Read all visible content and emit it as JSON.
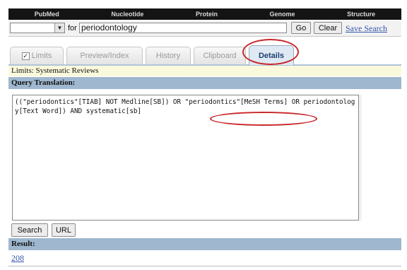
{
  "topnav": [
    "PubMed",
    "Nucleotide",
    "Protein",
    "Genome",
    "Structure"
  ],
  "search": {
    "for_label": "for",
    "term": "periodontology",
    "go_label": "Go",
    "clear_label": "Clear",
    "save_label": "Save Search"
  },
  "tabs": {
    "limits": "Limits",
    "preview": "Preview/Index",
    "history": "History",
    "clipboard": "Clipboard",
    "details": "Details"
  },
  "limits_text": "Limits: Systematic Reviews",
  "query_translation": {
    "header": "Query Translation:",
    "text": "((\"periodontics\"[TIAB] NOT Medline[SB]) OR \"periodontics\"[MeSH Terms] OR periodontology[Text Word]) AND systematic[sb]"
  },
  "buttons": {
    "search": "Search",
    "url": "URL"
  },
  "result": {
    "header": "Result:",
    "count": "208"
  },
  "colors": {
    "annotation": "#c8282a",
    "section_bar": "#9fb7cf",
    "limits_bar": "#fbf9dc",
    "link": "#3355aa"
  }
}
